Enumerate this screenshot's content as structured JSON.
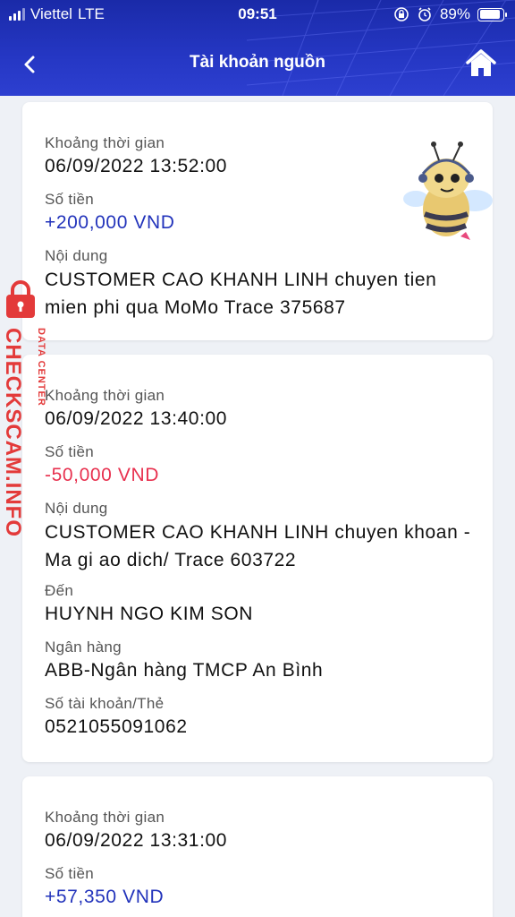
{
  "status_bar": {
    "carrier": "Viettel",
    "network": "LTE",
    "time": "09:51",
    "battery": "89%",
    "battery_level": 0.89
  },
  "nav": {
    "title": "Tài khoản nguồn",
    "back_icon": "chevron-left-icon",
    "home_icon": "home-icon"
  },
  "watermark": {
    "main": "CHECKSCAM.INFO",
    "sub": "DATA CENTER"
  },
  "colors": {
    "header": "#2537c4",
    "amount_positive": "#2233bb",
    "amount_negative": "#e8314f"
  },
  "transactions": [
    {
      "time_label": "Khoảng thời gian",
      "time": "06/09/2022 13:52:00",
      "amount_label": "Số tiền",
      "amount": "+200,000 VND",
      "content_label": "Nội dung",
      "content": "CUSTOMER CAO KHANH LINH chuyen tien mien phi  qua MoMo Trace 375687"
    },
    {
      "time_label": "Khoảng thời gian",
      "time": "06/09/2022 13:40:00",
      "amount_label": "Số tiền",
      "amount": "-50,000 VND",
      "content_label": "Nội dung",
      "content": "CUSTOMER CAO KHANH LINH chuyen khoan - Ma gi ao dich/ Trace 603722",
      "to_label": "Đến",
      "to": "HUYNH NGO KIM SON",
      "bank_label": "Ngân hàng",
      "bank": "ABB-Ngân hàng TMCP An Bình",
      "account_label": "Số tài khoản/Thẻ",
      "account": "0521055091062"
    },
    {
      "time_label": "Khoảng thời gian",
      "time": "06/09/2022 13:31:00",
      "amount_label": "Số tiền",
      "amount": "+57,350 VND"
    }
  ]
}
